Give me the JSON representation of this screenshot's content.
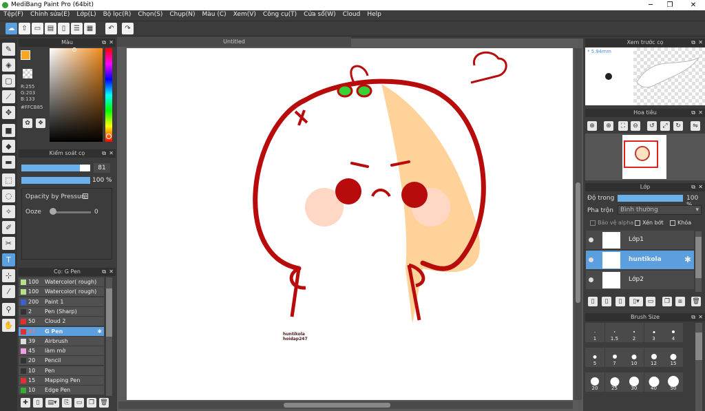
{
  "app": {
    "title": "MediBang Paint Pro (64bit)"
  },
  "menu": [
    "Tệp(F)",
    "Chỉnh sửa(E)",
    "Lớp(L)",
    "Bộ lọc(R)",
    "Chọn(S)",
    "Chụp(N)",
    "Màu (C)",
    "Xem(V)",
    "Công cụ(T)",
    "Cửa sổ(W)",
    "Cloud",
    "Help"
  ],
  "color_panel": {
    "title": "Màu",
    "r": "R:255",
    "g": "G:203",
    "b": "B:133",
    "hex": "#FFCB85",
    "primary": "#f5a623",
    "secondary": "#ffffff"
  },
  "brush_control": {
    "title": "Kiểm soát cọ",
    "size_value": "81",
    "opacity_value": "100 %",
    "pressure_label": "Opacity by Pressure",
    "ooze_label": "Ooze",
    "ooze_value": "0"
  },
  "brush_list": {
    "title": "Cọ: G Pen",
    "items": [
      {
        "size": "100",
        "name": "Watercolor( rough)",
        "color": "#b8e08a"
      },
      {
        "size": "100",
        "name": "Watercolor( rough)",
        "color": "#b8e08a"
      },
      {
        "size": "200",
        "name": "Paint 1",
        "color": "#3a5fd0"
      },
      {
        "size": "2",
        "name": "Pen (Sharp)",
        "color": "#333333"
      },
      {
        "size": "50",
        "name": "Cloud 2",
        "color": "#e03030"
      },
      {
        "size": "81",
        "name": "G Pen",
        "color": "#e03030",
        "selected": true
      },
      {
        "size": "39",
        "name": "Airbrush",
        "color": "#dddddd"
      },
      {
        "size": "45",
        "name": "làm mờ",
        "color": "#f0a0e0"
      },
      {
        "size": "20",
        "name": "Pencil",
        "color": "#333333"
      },
      {
        "size": "10",
        "name": "Pen",
        "color": "#333333"
      },
      {
        "size": "15",
        "name": "Mapping Pen",
        "color": "#e03030"
      },
      {
        "size": "10",
        "name": "Edge Pen",
        "color": "#30b030"
      }
    ]
  },
  "canvas": {
    "tab": "Untitled",
    "watermark_line1": "huntikola",
    "watermark_line2": "hoidap247"
  },
  "preview": {
    "title": "Xem trước cọ",
    "size": "* 5.94mm"
  },
  "navigator": {
    "title": "Hoa tiêu"
  },
  "layers": {
    "title": "Lớp",
    "opacity_label": "Độ trong",
    "opacity_value": "100 %",
    "blend_label": "Pha trộn",
    "blend_value": "Bình thường",
    "protect_alpha": "Bảo vệ alpha",
    "clipping": "Xén bớt",
    "lock": "Khóa",
    "items": [
      {
        "name": "Lớp1"
      },
      {
        "name": "huntikola",
        "selected": true
      },
      {
        "name": "Lớp2"
      }
    ]
  },
  "brush_size": {
    "title": "Brush Size",
    "sizes": [
      "1",
      "1.5",
      "2",
      "3",
      "4",
      "5",
      "7",
      "10",
      "12",
      "15",
      "20",
      "25",
      "30",
      "40",
      "50"
    ]
  }
}
